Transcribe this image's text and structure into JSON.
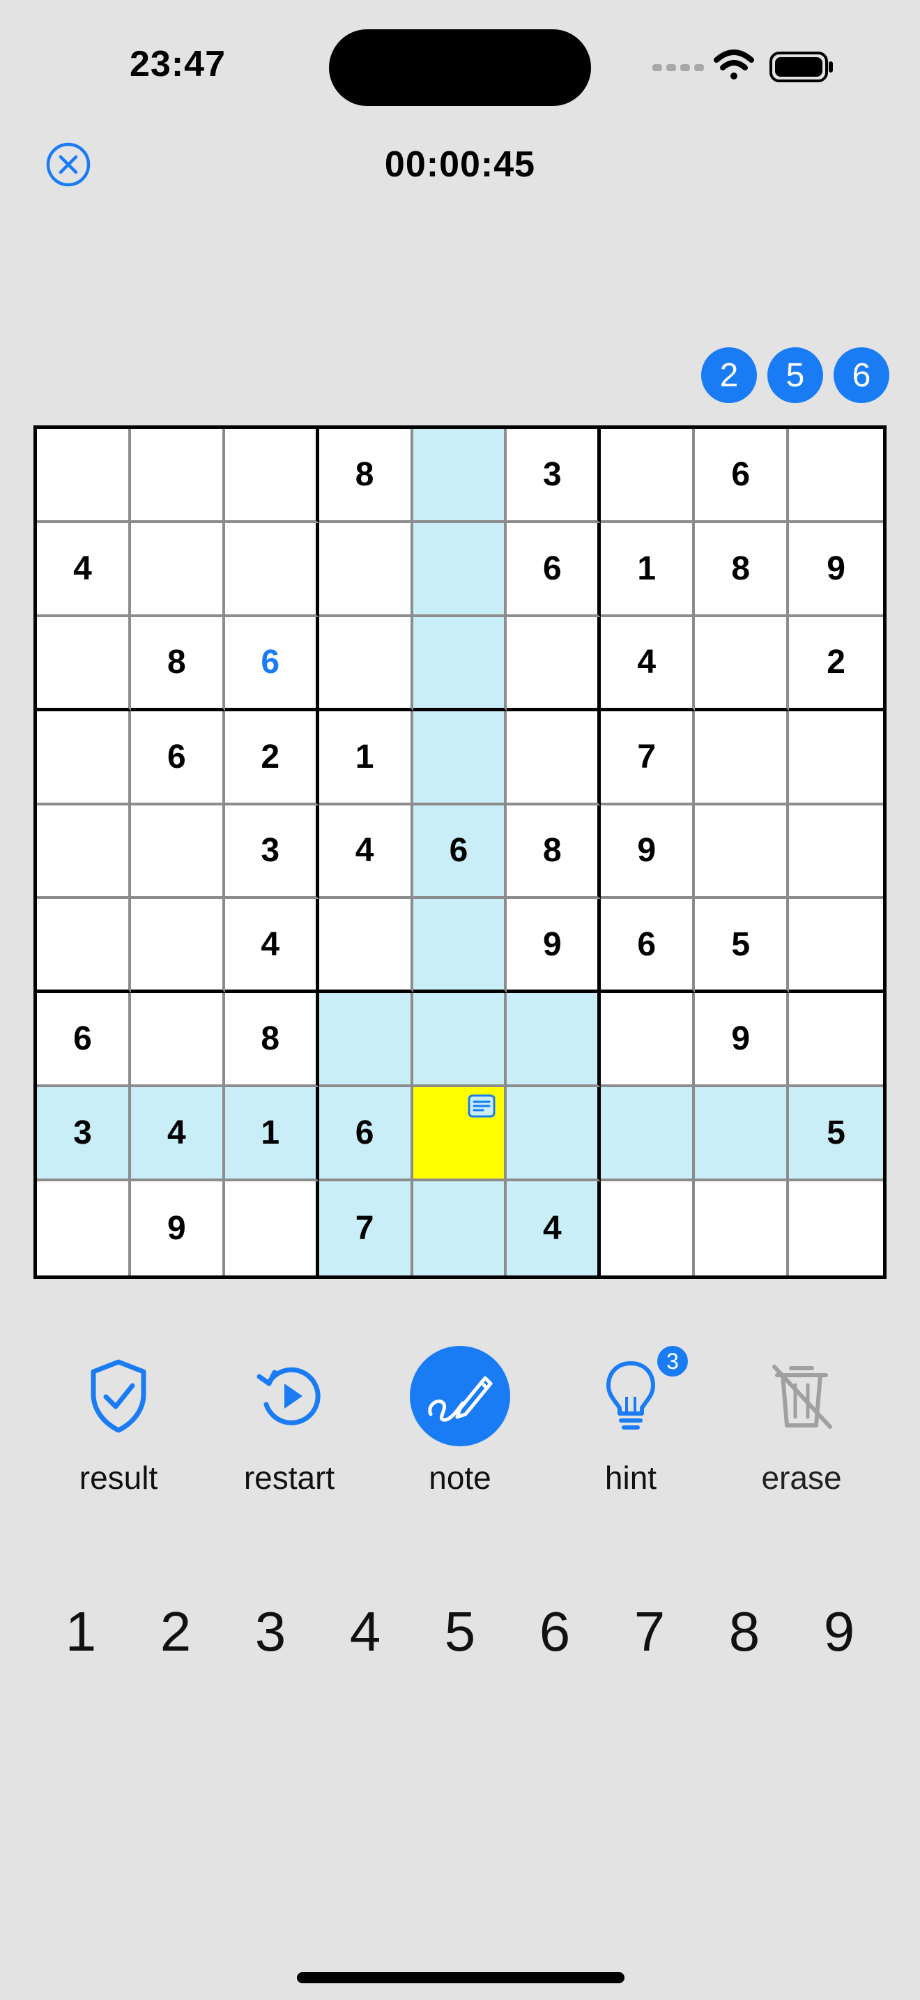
{
  "status": {
    "time": "23:47"
  },
  "header": {
    "timer": "00:00:45"
  },
  "candidates": [
    "2",
    "5",
    "6"
  ],
  "board": {
    "rows": [
      [
        "",
        "",
        "",
        "8",
        "",
        "3",
        "",
        "6",
        ""
      ],
      [
        "4",
        "",
        "",
        "",
        "",
        "6",
        "1",
        "8",
        "9"
      ],
      [
        "",
        "8",
        "6",
        "",
        "",
        "",
        "4",
        "",
        "2"
      ],
      [
        "",
        "6",
        "2",
        "1",
        "",
        "",
        "7",
        "",
        ""
      ],
      [
        "",
        "",
        "3",
        "4",
        "6",
        "8",
        "9",
        "",
        ""
      ],
      [
        "",
        "",
        "4",
        "",
        "",
        "9",
        "6",
        "5",
        ""
      ],
      [
        "6",
        "",
        "8",
        "",
        "",
        "",
        "",
        "9",
        ""
      ],
      [
        "3",
        "4",
        "1",
        "6",
        "",
        "",
        "",
        "",
        "5"
      ],
      [
        "",
        "9",
        "",
        "7",
        "",
        "4",
        "",
        "",
        ""
      ]
    ],
    "selected": [
      7,
      4
    ],
    "user_entered": [
      [
        2,
        2
      ]
    ],
    "selected_has_note": true
  },
  "toolbar": {
    "result": "result",
    "restart": "restart",
    "note": "note",
    "hint": "hint",
    "hint_count": "3",
    "erase": "erase"
  },
  "numpad": [
    "1",
    "2",
    "3",
    "4",
    "5",
    "6",
    "7",
    "8",
    "9"
  ],
  "colors": {
    "accent": "#1a7cf5",
    "highlight": "#c9eef8",
    "selected": "#ffff00",
    "background": "#e3e3e3"
  },
  "icons": {
    "close": "close-circle-icon",
    "result": "shield-check-icon",
    "restart": "restart-play-icon",
    "note": "pencil-icon",
    "hint": "lightbulb-icon",
    "erase": "trash-disabled-icon"
  }
}
